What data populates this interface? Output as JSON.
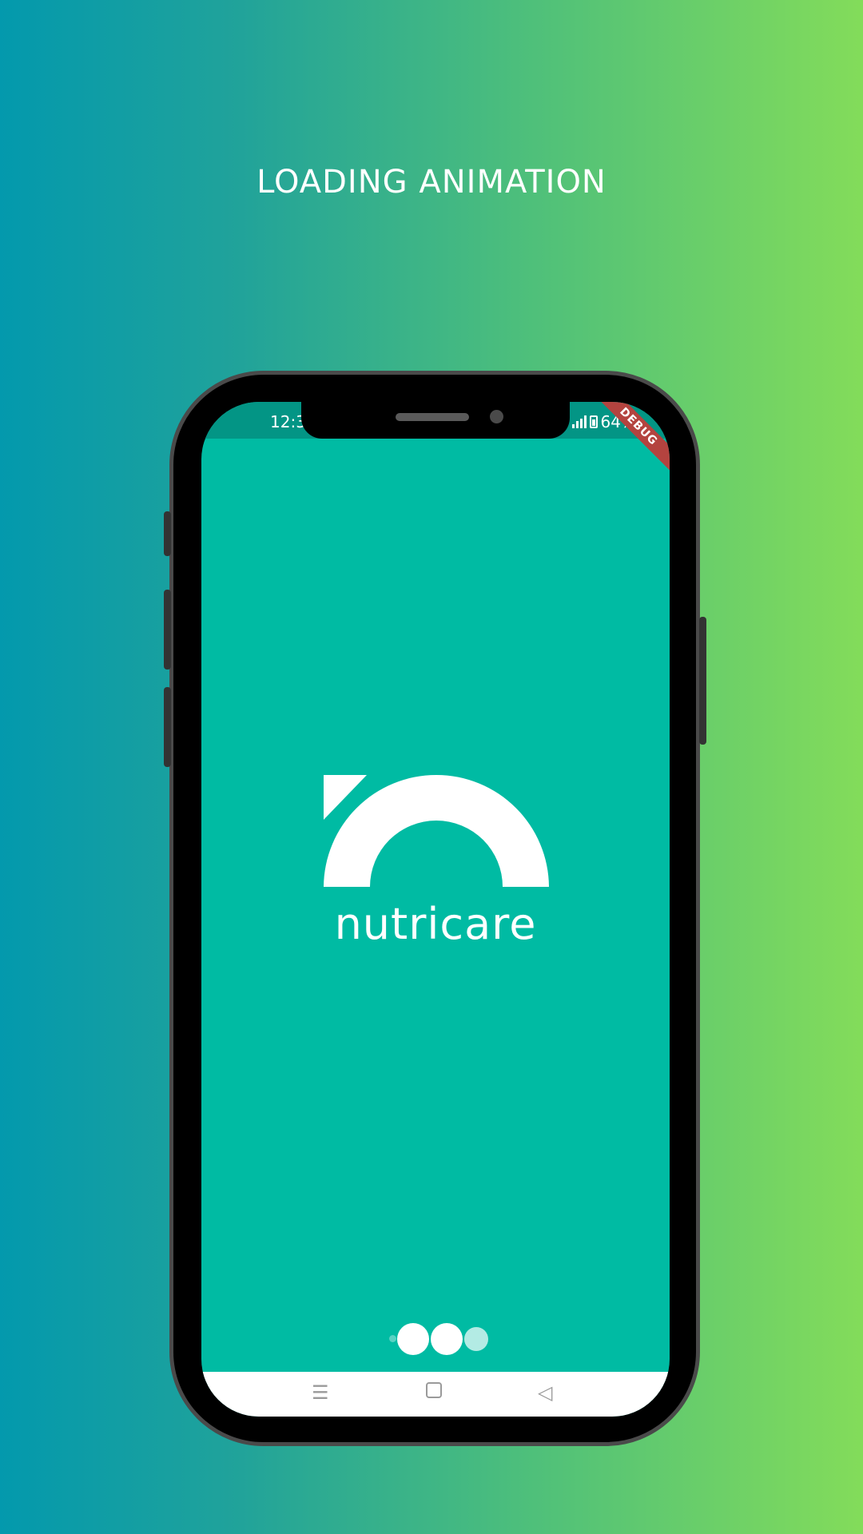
{
  "heading": "LOADING ANIMATION",
  "status_bar": {
    "time": "12:3",
    "battery": "64%"
  },
  "debug_banner": "DEBUG",
  "app": {
    "brand": "nutricare"
  },
  "loading_dots": {
    "count": 4
  },
  "nav_bar": {
    "menu_icon": "menu-icon",
    "home_icon": "home-square-icon",
    "back_icon": "back-triangle-icon"
  },
  "colors": {
    "screen": "#00bba3",
    "status_bar": "#039585",
    "debug": "#b4433f"
  }
}
